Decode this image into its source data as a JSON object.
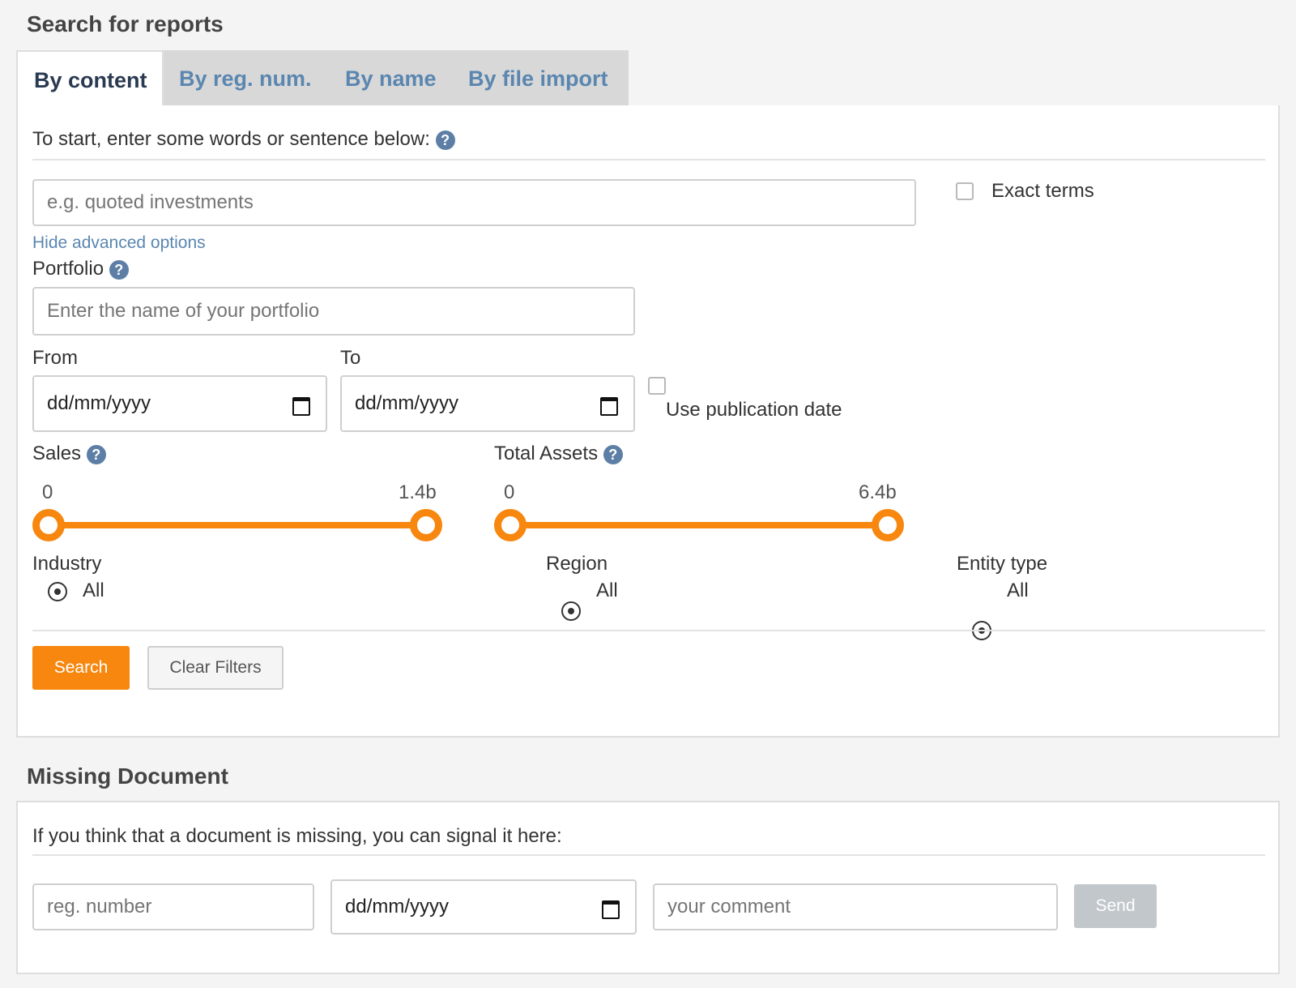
{
  "search_section": {
    "title": "Search for reports",
    "tabs": [
      {
        "label": "By content",
        "active": true
      },
      {
        "label": "By reg. num.",
        "active": false
      },
      {
        "label": "By name",
        "active": false
      },
      {
        "label": "By file import",
        "active": false
      }
    ],
    "intro_text": "To start, enter some words or sentence below:",
    "query_placeholder": "e.g. quoted investments",
    "exact_terms_label": "Exact terms",
    "exact_terms_checked": false,
    "advanced_toggle": "Hide advanced options",
    "portfolio_label": "Portfolio",
    "portfolio_placeholder": "Enter the name of your portfolio",
    "from_label": "From",
    "from_value": "dd/mm/yyyy",
    "to_label": "To",
    "to_value": "dd/mm/yyyy",
    "publication_date_label": "Use publication date",
    "publication_date_checked": false,
    "sales": {
      "label": "Sales",
      "min": "0",
      "max": "1.4b"
    },
    "total_assets": {
      "label": "Total Assets",
      "min": "0",
      "max": "6.4b"
    },
    "industry": {
      "label": "Industry",
      "option": "All"
    },
    "region": {
      "label": "Region",
      "option": "All"
    },
    "entity_type": {
      "label": "Entity type",
      "option": "All"
    },
    "search_button": "Search",
    "clear_button": "Clear Filters"
  },
  "missing_section": {
    "title": "Missing Document",
    "intro_text": "If you think that a document is missing, you can signal it here:",
    "reg_placeholder": "reg. number",
    "date_value": "dd/mm/yyyy",
    "comment_placeholder": "your comment",
    "send_button": "Send"
  },
  "help_glyph": "?",
  "colors": {
    "accent": "#f7870f",
    "link": "#5a86b0",
    "help_icon": "#5d7fa6",
    "disabled_button": "#c2c7cc"
  }
}
